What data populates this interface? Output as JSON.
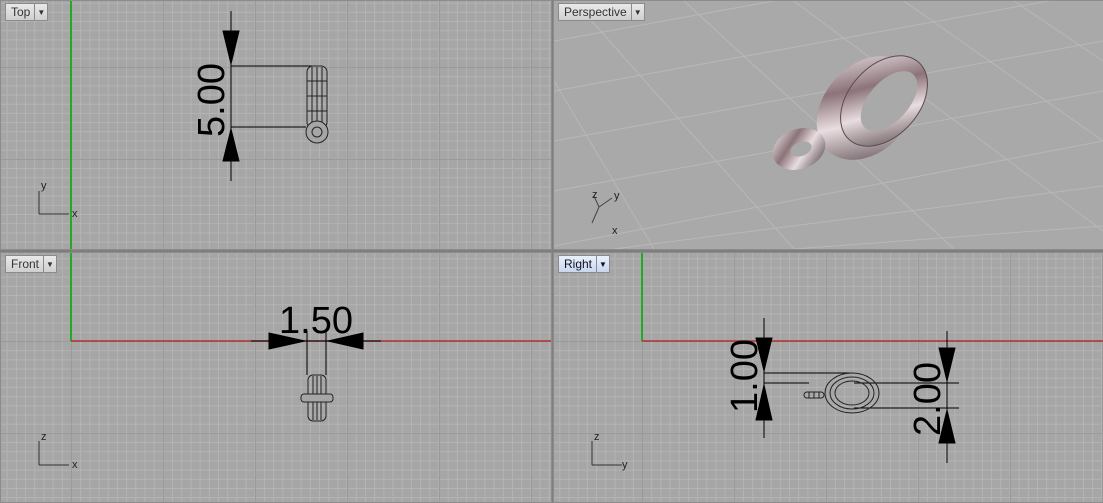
{
  "viewports": {
    "top": {
      "label": "Top"
    },
    "persp": {
      "label": "Perspective"
    },
    "front": {
      "label": "Front"
    },
    "right": {
      "label": "Right"
    }
  },
  "dimensions": {
    "top_height": "5.00",
    "front_width": "1.50",
    "right_small": "1.00",
    "right_large": "2.00"
  },
  "axes": {
    "top": {
      "h": "x",
      "v": "y"
    },
    "front": {
      "h": "x",
      "v": "z"
    },
    "right": {
      "h": "y",
      "v": "z"
    },
    "persp": {
      "a": "z",
      "b": "y",
      "c": "x"
    }
  },
  "colors": {
    "viewport_bg": "#a6a6a6",
    "x_axis": "#b03030",
    "y_axis": "#2fa82f",
    "active_tab": "#c8d7ee"
  },
  "icons": {
    "dropdown": "chevron-down-icon"
  }
}
